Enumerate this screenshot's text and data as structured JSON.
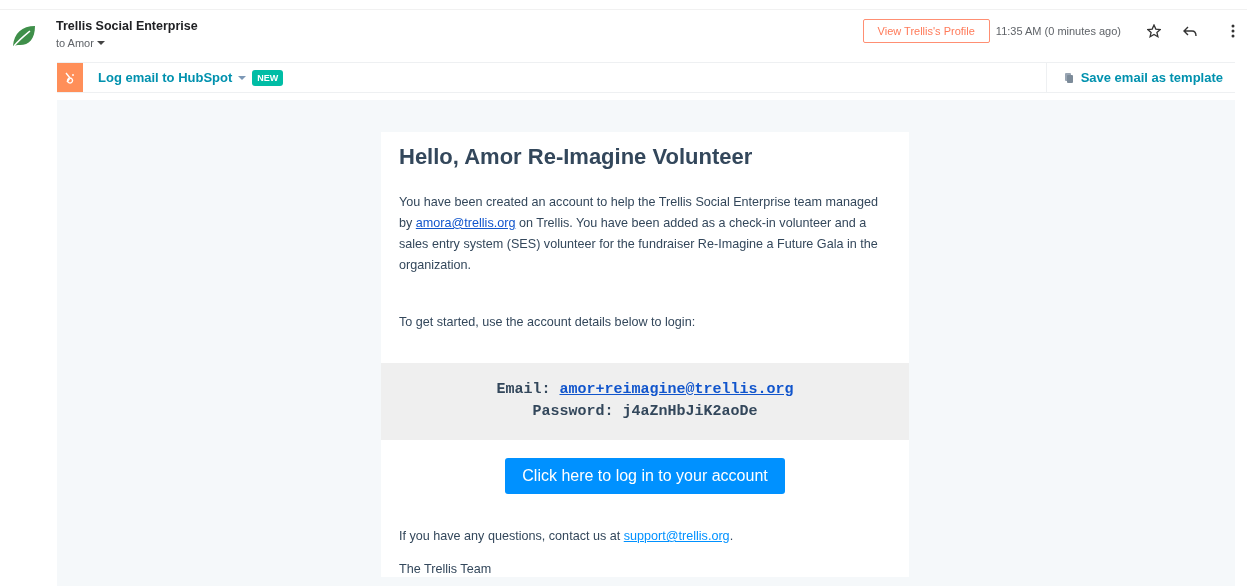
{
  "sender": {
    "name": "Trellis Social Enterprise",
    "recipient": "to Amor"
  },
  "header_actions": {
    "profile_button": "View Trellis's Profile",
    "timestamp": "11:35 AM (0 minutes ago)",
    "starred": false
  },
  "hubspot": {
    "log_label": "Log email to HubSpot",
    "badge": "NEW",
    "template_label": "Save email as template"
  },
  "email": {
    "greeting": "Hello, Amor Re-Imagine Volunteer",
    "intro": [
      {
        "kind": "text",
        "text": "You have been created an account to help the Trellis Social Enterprise team managed by "
      },
      {
        "kind": "link",
        "text": "amora@trellis.org"
      },
      {
        "kind": "text",
        "text": " on Trellis. You have been added as a check-in volunteer and a sales entry system (SES) volunteer for the fundraiser Re-Imagine a Future Gala in the organization."
      }
    ],
    "instructions": "To get started, use the account details below to login:",
    "credentials": [
      {
        "label": "Email:",
        "value": "amor+reimagine@trellis.org",
        "kind": "link"
      },
      {
        "label": "Password:",
        "value": "j4aZnHbJiK2aoDe",
        "kind": "text"
      }
    ],
    "login_button": "Click here to log in to your account",
    "contact": [
      {
        "kind": "text",
        "text": "If you have any questions, contact us at "
      },
      {
        "kind": "link",
        "text": "support@trellis.org"
      },
      {
        "kind": "text",
        "text": "."
      }
    ],
    "signoff": "The Trellis Team"
  }
}
